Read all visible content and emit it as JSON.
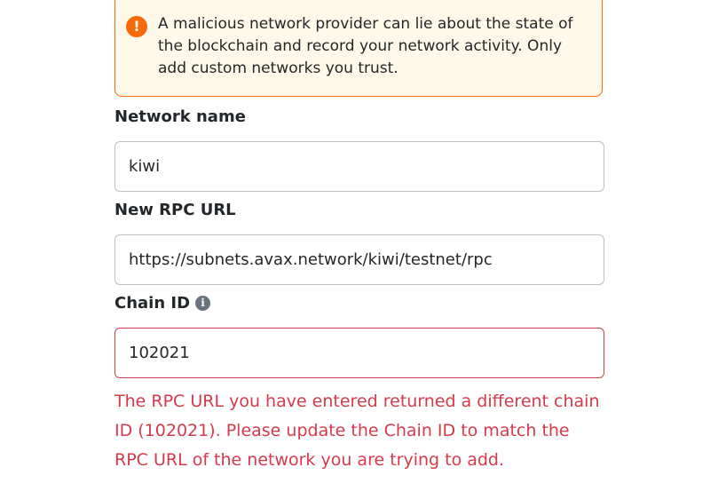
{
  "warning": {
    "icon": "warning-icon",
    "text": "A malicious network provider can lie about the state of the blockchain and record your network activity. Only add custom networks you trust."
  },
  "network_name": {
    "label": "Network name",
    "value": "kiwi"
  },
  "rpc_url": {
    "label": "New RPC URL",
    "value": "https://subnets.avax.network/kiwi/testnet/rpc"
  },
  "chain_id": {
    "label": "Chain ID",
    "info_icon": "info-icon",
    "value": "102021",
    "error": "The RPC URL you have entered returned a different chain ID (102021). Please update the Chain ID to match the RPC URL of the network you are trying to add."
  },
  "colors": {
    "warning_border": "#f66a0a",
    "warning_bg": "#fef8e8",
    "error": "#d73a49",
    "input_border": "#bbc0c5"
  }
}
